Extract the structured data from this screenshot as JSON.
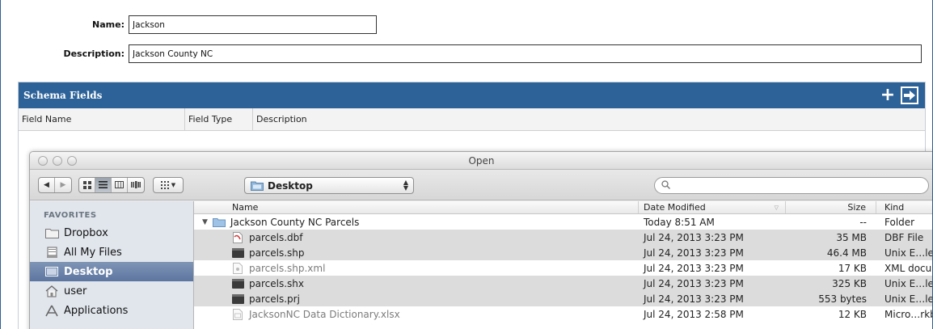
{
  "form": {
    "name_label": "Name:",
    "name_value": "Jackson",
    "description_label": "Description:",
    "description_value": "Jackson County NC"
  },
  "schema": {
    "title": "Schema Fields",
    "columns": [
      "Field Name",
      "Field Type",
      "Description"
    ]
  },
  "dialog": {
    "title": "Open",
    "location": "Desktop",
    "search_placeholder": "",
    "sidebar_heading": "FAVORITES",
    "sidebar_items": [
      {
        "label": "Dropbox",
        "icon": "folder-icon"
      },
      {
        "label": "All My Files",
        "icon": "all-files-icon"
      },
      {
        "label": "Desktop",
        "icon": "desktop-icon"
      },
      {
        "label": "user",
        "icon": "home-icon"
      },
      {
        "label": "Applications",
        "icon": "applications-icon"
      }
    ],
    "selected_sidebar": "Desktop",
    "columns": {
      "name": "Name",
      "date": "Date Modified",
      "size": "Size",
      "kind": "Kind"
    },
    "files": [
      {
        "name": "Jackson County NC Parcels",
        "date": "Today 8:51 AM",
        "size": "--",
        "kind": "Folder",
        "icon": "folder-icon"
      },
      {
        "name": "parcels.dbf",
        "date": "Jul 24, 2013 3:23 PM",
        "size": "35 MB",
        "kind": "DBF File",
        "icon": "dbf-file-icon"
      },
      {
        "name": "parcels.shp",
        "date": "Jul 24, 2013 3:23 PM",
        "size": "46.4 MB",
        "kind": "Unix E…le I",
        "icon": "unix-exec-icon"
      },
      {
        "name": "parcels.shp.xml",
        "date": "Jul 24, 2013 3:23 PM",
        "size": "17 KB",
        "kind": "XML docum",
        "icon": "xml-file-icon"
      },
      {
        "name": "parcels.shx",
        "date": "Jul 24, 2013 3:23 PM",
        "size": "325 KB",
        "kind": "Unix E…le I",
        "icon": "unix-exec-icon"
      },
      {
        "name": "parcels.prj",
        "date": "Jul 24, 2013 3:23 PM",
        "size": "553 bytes",
        "kind": "Unix E…le I",
        "icon": "unix-exec-icon"
      },
      {
        "name": "JacksonNC Data Dictionary.xlsx",
        "date": "Jul 24, 2013 2:58 PM",
        "size": "12 KB",
        "kind": "Micro…rkb",
        "icon": "xlsx-file-icon"
      }
    ]
  },
  "colors": {
    "accent": "#2d6298",
    "selection": "#5d76a0"
  }
}
